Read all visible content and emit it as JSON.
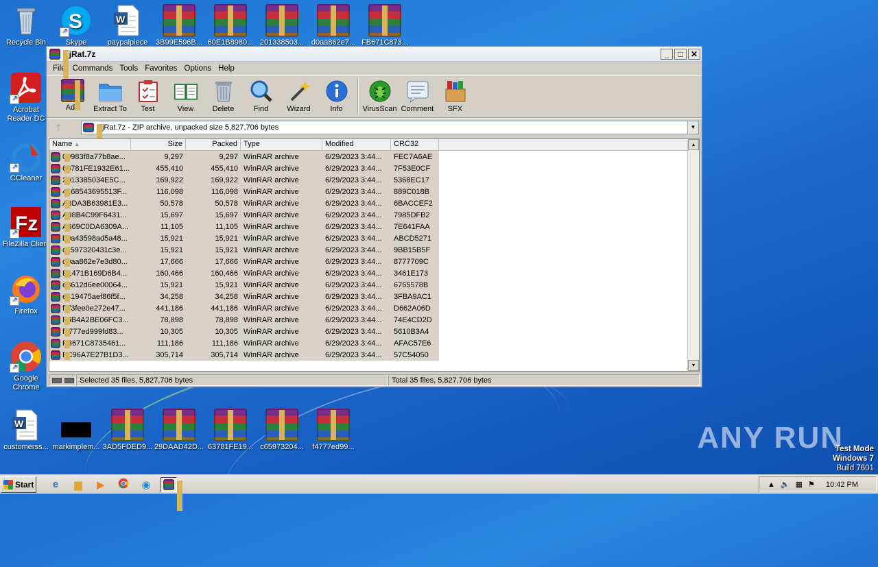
{
  "desktop": {
    "left_icons": [
      {
        "label": "Recycle Bin",
        "icon": "recycle-bin-icon"
      },
      {
        "label": "Acrobat Reader DC",
        "icon": "acrobat-icon"
      },
      {
        "label": "CCleaner",
        "icon": "ccleaner-icon"
      },
      {
        "label": "FileZilla Client",
        "icon": "filezilla-icon"
      },
      {
        "label": "Firefox",
        "icon": "firefox-icon"
      },
      {
        "label": "Google Chrome",
        "icon": "chrome-icon"
      },
      {
        "label": "customerss...",
        "icon": "word-doc-icon"
      }
    ],
    "top_icons": [
      {
        "label": "Skype",
        "icon": "skype-icon"
      },
      {
        "label": "paypalpiece",
        "icon": "word-doc-icon"
      },
      {
        "label": "3B99E596B...",
        "icon": "rar-archive-icon"
      },
      {
        "label": "60E1B8980...",
        "icon": "rar-archive-icon"
      },
      {
        "label": "201338503...",
        "icon": "rar-archive-icon"
      },
      {
        "label": "d0aa862e7...",
        "icon": "rar-archive-icon"
      },
      {
        "label": "FB671C873...",
        "icon": "rar-archive-icon"
      }
    ],
    "bottom_icons": [
      {
        "label": "markimplem...",
        "icon": "black-file-icon"
      },
      {
        "label": "3AD5FDED9...",
        "icon": "rar-archive-icon"
      },
      {
        "label": "29DAAD42D...",
        "icon": "rar-archive-icon"
      },
      {
        "label": "63781FE19...",
        "icon": "rar-archive-icon"
      },
      {
        "label": "c65973204...",
        "icon": "rar-archive-icon"
      },
      {
        "label": "f4777ed99...",
        "icon": "rar-archive-icon"
      }
    ],
    "watermark": "ANY RUN",
    "test_mode": {
      "line1": "Test Mode",
      "line2": "Windows 7",
      "line3": "Build 7601"
    }
  },
  "window": {
    "title": "NjRat.7z",
    "menu": [
      "File",
      "Commands",
      "Tools",
      "Favorites",
      "Options",
      "Help"
    ],
    "toolbar": [
      {
        "label": "Add",
        "icon": "add-archive-icon"
      },
      {
        "label": "Extract To",
        "icon": "extract-folder-icon"
      },
      {
        "label": "Test",
        "icon": "test-clipboard-icon"
      },
      {
        "label": "View",
        "icon": "view-book-icon"
      },
      {
        "label": "Delete",
        "icon": "trash-icon"
      },
      {
        "label": "Find",
        "icon": "magnifier-icon"
      },
      {
        "label": "Wizard",
        "icon": "wizard-wand-icon"
      },
      {
        "label": "Info",
        "icon": "info-icon"
      },
      {
        "label": "VirusScan",
        "icon": "virus-scan-icon"
      },
      {
        "label": "Comment",
        "icon": "comment-icon"
      },
      {
        "label": "SFX",
        "icon": "sfx-box-icon"
      }
    ],
    "address": "NjRat.7z - ZIP archive, unpacked size 5,827,706 bytes",
    "columns": [
      "Name",
      "Size",
      "Packed",
      "Type",
      "Modified",
      "CRC32"
    ],
    "files": [
      {
        "name": "09983f8a77b8ae...",
        "size": "9,297",
        "packed": "9,297",
        "type": "WinRAR archive",
        "modified": "6/29/2023 3:44...",
        "crc": "FEC7A6AE"
      },
      {
        "name": "63781FE1932E61...",
        "size": "455,410",
        "packed": "455,410",
        "type": "WinRAR archive",
        "modified": "6/29/2023 3:44...",
        "crc": "7F53E0CF"
      },
      {
        "name": "2013385034E5C...",
        "size": "169,922",
        "packed": "169,922",
        "type": "WinRAR archive",
        "modified": "6/29/2023 3:44...",
        "crc": "5368EC17"
      },
      {
        "name": "4168543695513F...",
        "size": "116,098",
        "packed": "116,098",
        "type": "WinRAR archive",
        "modified": "6/29/2023 3:44...",
        "crc": "889C018B"
      },
      {
        "name": "A6DA3B63981E3...",
        "size": "50,578",
        "packed": "50,578",
        "type": "WinRAR archive",
        "modified": "6/29/2023 3:44...",
        "crc": "6BACCEF2"
      },
      {
        "name": "A98B4C99F6431...",
        "size": "15,697",
        "packed": "15,697",
        "type": "WinRAR archive",
        "modified": "6/29/2023 3:44...",
        "crc": "7985DFB2"
      },
      {
        "name": "A669C0DA6309A...",
        "size": "11,105",
        "packed": "11,105",
        "type": "WinRAR archive",
        "modified": "6/29/2023 3:44...",
        "crc": "7E641FAA"
      },
      {
        "name": "b0a43598ad5a48...",
        "size": "15,921",
        "packed": "15,921",
        "type": "WinRAR archive",
        "modified": "6/29/2023 3:44...",
        "crc": "ABCD5271"
      },
      {
        "name": "c6597320431c3e...",
        "size": "15,921",
        "packed": "15,921",
        "type": "WinRAR archive",
        "modified": "6/29/2023 3:44...",
        "crc": "9BB15B5F"
      },
      {
        "name": "d0aa862e7e3d80...",
        "size": "17,666",
        "packed": "17,666",
        "type": "WinRAR archive",
        "modified": "6/29/2023 3:44...",
        "crc": "8777709C"
      },
      {
        "name": "E1471B169D6B4...",
        "size": "160,466",
        "packed": "160,466",
        "type": "WinRAR archive",
        "modified": "6/29/2023 3:44...",
        "crc": "3461E173"
      },
      {
        "name": "e3612d6ee00064...",
        "size": "15,921",
        "packed": "15,921",
        "type": "WinRAR archive",
        "modified": "6/29/2023 3:44...",
        "crc": "6765578B"
      },
      {
        "name": "e419475aef86f5f...",
        "size": "34,258",
        "packed": "34,258",
        "type": "WinRAR archive",
        "modified": "6/29/2023 3:44...",
        "crc": "3FBA9AC1"
      },
      {
        "name": "f3f3fee0e272e47...",
        "size": "441,186",
        "packed": "441,186",
        "type": "WinRAR archive",
        "modified": "6/29/2023 3:44...",
        "crc": "D662A06D"
      },
      {
        "name": "F6B4A2BE06FC3...",
        "size": "78,898",
        "packed": "78,898",
        "type": "WinRAR archive",
        "modified": "6/29/2023 3:44...",
        "crc": "74E4CD2D"
      },
      {
        "name": "f4777ed999fd83...",
        "size": "10,305",
        "packed": "10,305",
        "type": "WinRAR archive",
        "modified": "6/29/2023 3:44...",
        "crc": "5610B3A4"
      },
      {
        "name": "FB671C8735461...",
        "size": "111,186",
        "packed": "111,186",
        "type": "WinRAR archive",
        "modified": "6/29/2023 3:44...",
        "crc": "AFAC57E6"
      },
      {
        "name": "FC96A7E27B1D3...",
        "size": "305,714",
        "packed": "305,714",
        "type": "WinRAR archive",
        "modified": "6/29/2023 3:44...",
        "crc": "57C54050"
      }
    ],
    "status_left": "Selected 35 files, 5,827,706 bytes",
    "status_right": "Total 35 files, 5,827,706 bytes"
  },
  "taskbar": {
    "start_label": "Start",
    "icons": [
      "ie-icon",
      "explorer-folder-icon",
      "media-player-icon",
      "chrome-icon",
      "edge-icon",
      "winrar-icon"
    ],
    "clock": "10:42 PM"
  }
}
